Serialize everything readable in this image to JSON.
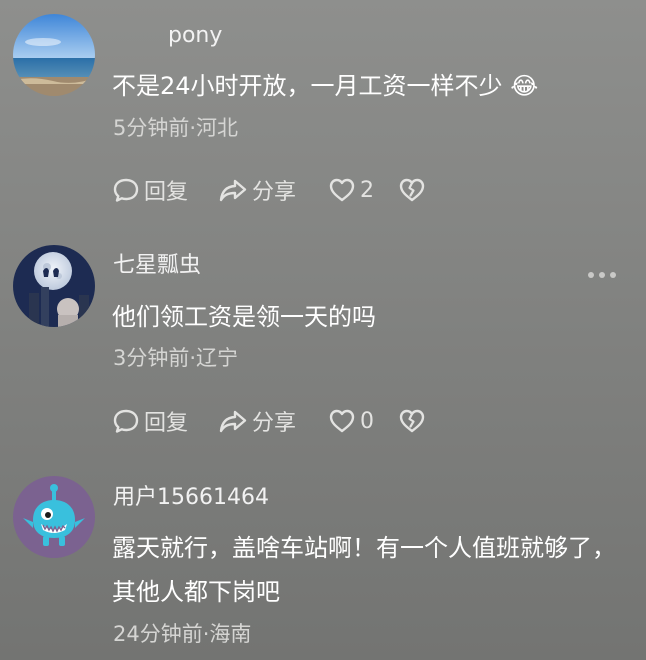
{
  "actions": {
    "reply_label": "回复",
    "share_label": "分享"
  },
  "comments": [
    {
      "author": "pony",
      "text": "不是24小时开放，一月工资一样不少",
      "emoji": "😂",
      "time": "5分钟前",
      "location": "河北",
      "meta": "5分钟前·河北",
      "likes": "2"
    },
    {
      "author": "七星瓢虫",
      "text": "他们领工资是领一天的吗",
      "time": "3分钟前",
      "location": "辽宁",
      "meta": "3分钟前·辽宁",
      "likes": "0"
    },
    {
      "author": "用户15661464",
      "text": "露天就行，盖啥车站啊！有一个人值班就够了，其他人都下岗吧",
      "time": "24分钟前",
      "location": "海南",
      "meta": "24分钟前·海南"
    }
  ],
  "icons": {
    "reply": "speech-bubble-icon",
    "share": "share-arrow-icon",
    "like": "heart-icon",
    "dislike": "broken-heart-icon",
    "more": "more-dots-icon"
  }
}
